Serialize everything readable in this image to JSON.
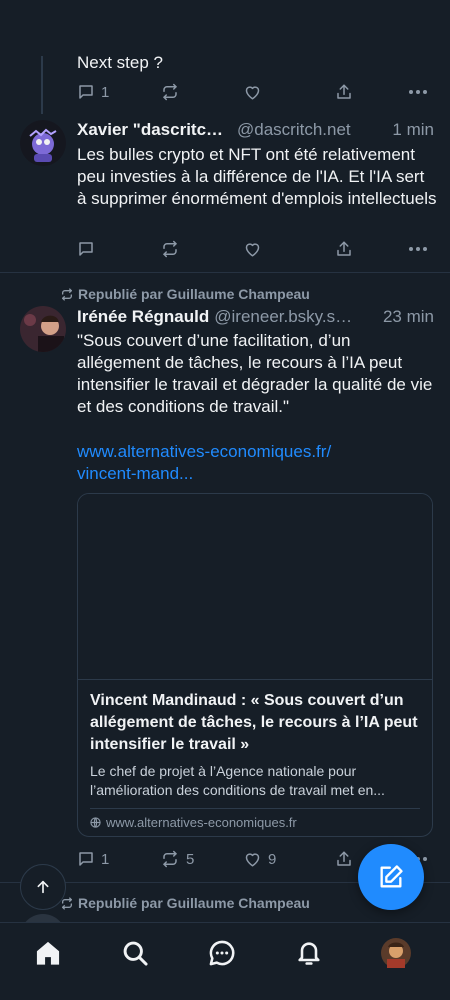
{
  "colors": {
    "background": "#161e27",
    "text": "#f1f3f5",
    "muted": "#8d99a7",
    "accent": "#208bfe",
    "border": "#2c3a4a"
  },
  "post_top": {
    "text": "Next step ?",
    "replies": "1",
    "reposts": "",
    "likes": ""
  },
  "post_xavier": {
    "author": "Xavier \"dascritch\" Cazin",
    "handle": "@dascritch.net",
    "time": "1 min",
    "text": "Les bulles crypto et NFT ont été relativement peu investies à la différence de l'IA. Et l'IA sert à supprimer énormément d'emplois intellectuels",
    "replies": "",
    "reposts": "",
    "likes": ""
  },
  "post_irenee": {
    "repost_label": "Republié par Guillaume Champeau",
    "author": "Irénée Régnauld",
    "handle": "@ireneer.bsky.social",
    "time": "23 min",
    "text": "\"Sous couvert d’une facilitation, d’un allégement de tâches, le recours à l’IA peut intensifier le travail et dégrader la qualité de vie et des conditions de travail.\"",
    "link_line1": "www.alternatives-economiques.fr/",
    "link_line2": "vincent-mand...",
    "card": {
      "title": "Vincent Mandinaud : « Sous couvert d’un allégement de tâches, le recours à l’IA peut intensifier le travail »",
      "description": "Le chef de projet à l’Agence nationale pour l’amélioration des conditions de travail met en...",
      "domain": "www.alternatives-economiques.fr"
    },
    "replies": "1",
    "reposts": "5",
    "likes": "9"
  },
  "post_next": {
    "repost_label": "Republié par Guillaume Champeau"
  },
  "icons": {
    "reply": "reply-icon",
    "repost": "repost-icon",
    "like": "heart-icon",
    "share": "share-icon",
    "more": "more-icon",
    "scroll_top": "arrow-up-icon",
    "compose": "compose-icon",
    "home": "home-icon",
    "search": "search-icon",
    "chat": "chat-icon",
    "notifications": "bell-icon"
  }
}
